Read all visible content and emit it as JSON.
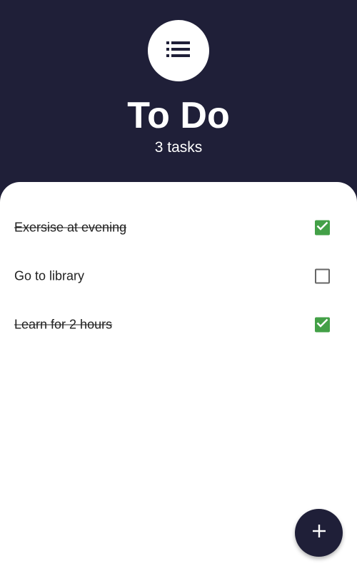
{
  "header": {
    "title": "To Do",
    "subtitle": "3 tasks",
    "icon": "list-icon"
  },
  "tasks": [
    {
      "label": "Exersise at evening",
      "done": true
    },
    {
      "label": "Go to library",
      "done": false
    },
    {
      "label": "Learn for 2 hours",
      "done": true
    }
  ],
  "fab": {
    "icon": "add-icon"
  },
  "colors": {
    "header_bg": "#1f1f38",
    "panel_bg": "#ffffff",
    "checkbox_checked": "#43a047",
    "text": "#222222"
  }
}
